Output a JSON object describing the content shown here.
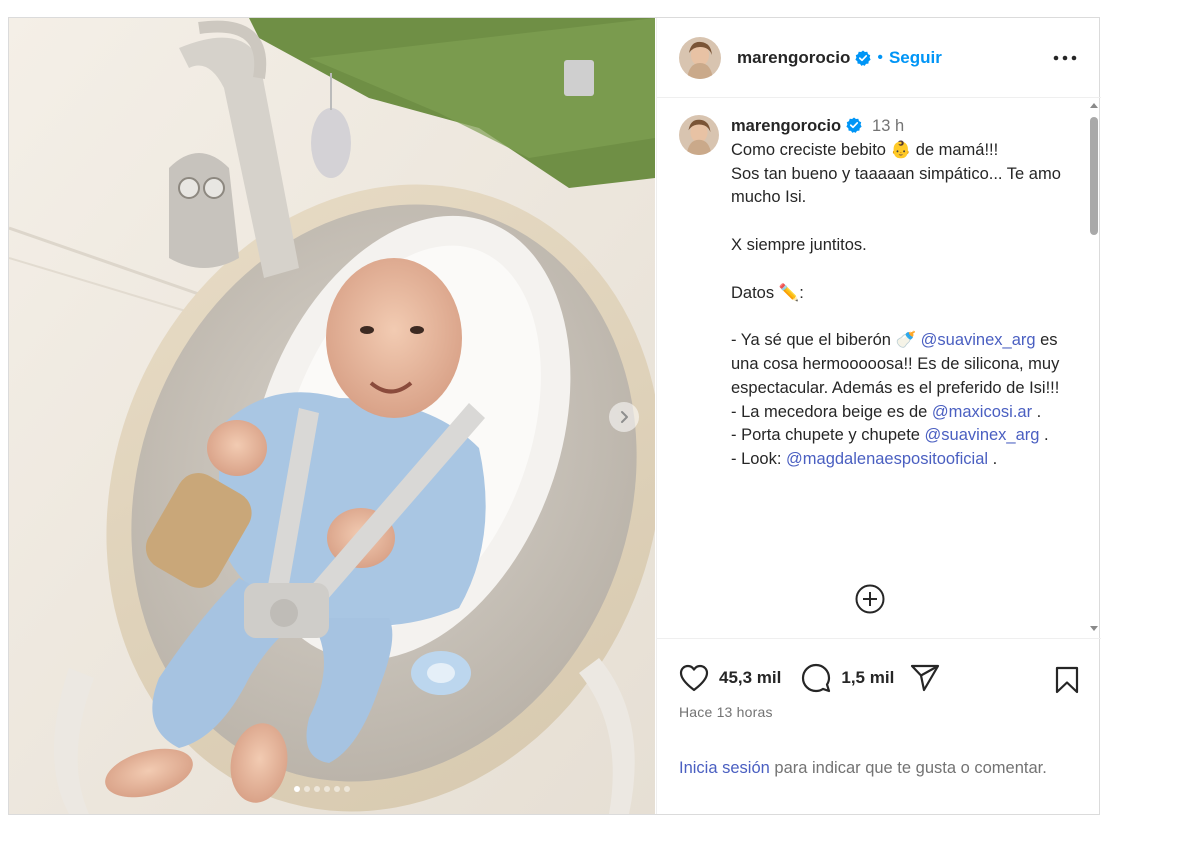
{
  "post": {
    "username": "marengorocio",
    "follow_label": "Seguir",
    "separator": "•",
    "time_short": "13 h",
    "caption_line1": "Como creciste bebito 👶 de mamá!!!\nSos tan bueno y taaaaan simpático... Te amo mucho Isi.",
    "caption_line2": "X siempre juntitos.",
    "caption_line3": "Datos ✏️:",
    "caption_item1_pre": "- Ya sé que el biberón 🍼 ",
    "caption_item1_mention": "@suavinex_arg",
    "caption_item1_post": " es una cosa hermooooosa!! Es de silicona, muy espectacular. Además es el preferido de Isi!!!",
    "caption_item2_pre": "- La mecedora beige es de ",
    "caption_item2_mention": "@maxicosi.ar",
    "caption_item2_post": " .",
    "caption_item3_pre": "- Porta chupete y chupete ",
    "caption_item3_mention": "@suavinex_arg",
    "caption_item3_post": " .",
    "caption_item4_pre": "- Look: ",
    "caption_item4_mention": "@magdalenaespositooficial",
    "caption_item4_post": " ."
  },
  "stats": {
    "likes": "45,3 mil",
    "comments": "1,5 mil"
  },
  "posted_ago": "Hace 13 horas",
  "login_prompt": {
    "link_text": "Inicia sesión",
    "rest": " para indicar que te gusta o comentar."
  },
  "carousel": {
    "total": 6,
    "current": 1
  },
  "icons": {
    "verified": "verified-badge-icon",
    "more": "more-options-icon",
    "heart": "heart-icon",
    "comment": "comment-icon",
    "share": "share-icon",
    "save": "bookmark-icon",
    "load_more": "plus-circle-icon",
    "next": "chevron-right-icon"
  },
  "colors": {
    "accent": "#0095f6",
    "mention": "#4a5fc1",
    "muted": "#737373",
    "text": "#262626"
  }
}
